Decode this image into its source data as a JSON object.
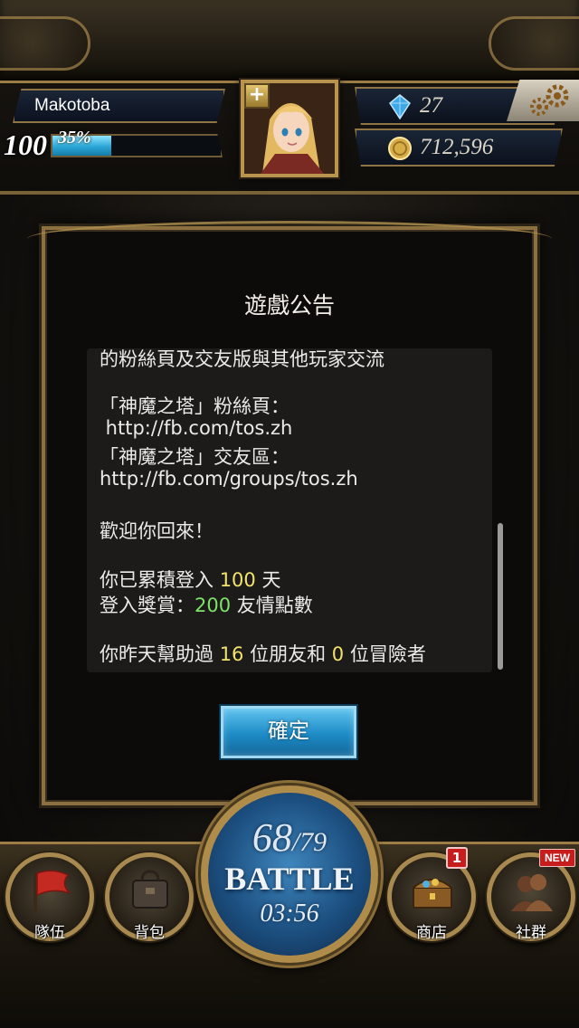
{
  "player": {
    "name": "Makotoba",
    "level": "100",
    "exp_percent_label": "35%",
    "exp_fraction": 0.35
  },
  "resources": {
    "gems": "27",
    "coins": "712,596"
  },
  "dialog": {
    "title": "遊戲公告",
    "lines": [
      "的粉絲頁及交友版與其他玩家交流",
      "「神魔之塔」粉絲頁：",
      " http://fb.com/tos.zh",
      "「神魔之塔」交友區：",
      "http://fb.com/groups/tos.zh",
      "歡迎你回來！"
    ],
    "login_days": {
      "prefix": "你已累積登入 ",
      "value": "100",
      "suffix": " 天"
    },
    "login_reward": {
      "prefix": "登入獎賞：",
      "value": "200",
      "suffix": " 友情點數"
    },
    "helped": {
      "prefix": "你昨天幫助過 ",
      "friends": "16",
      "middle": " 位朋友和 ",
      "adventurers": "0",
      "suffix": " 位冒險者"
    },
    "confirm_label": "確定"
  },
  "nav": {
    "team": "隊伍",
    "bag": "背包",
    "shop": "商店",
    "shop_badge": "1",
    "social": "社群",
    "social_badge": "NEW"
  },
  "battle": {
    "stamina_current": "68",
    "stamina_max": "/79",
    "label": "BATTLE",
    "timer": "03:56"
  },
  "colors": {
    "highlight_yellow": "#f2e36d",
    "highlight_green": "#7ee36a",
    "exp_bar": "#2aa6d6",
    "gold_trim": "#a8894f"
  },
  "icons": {
    "plus": "plus-icon",
    "gem": "gem-icon",
    "coin": "coin-icon",
    "settings": "gears-icon",
    "team": "flag-icon",
    "bag": "bag-icon",
    "shop": "treasure-chest-icon",
    "social": "people-icon"
  }
}
